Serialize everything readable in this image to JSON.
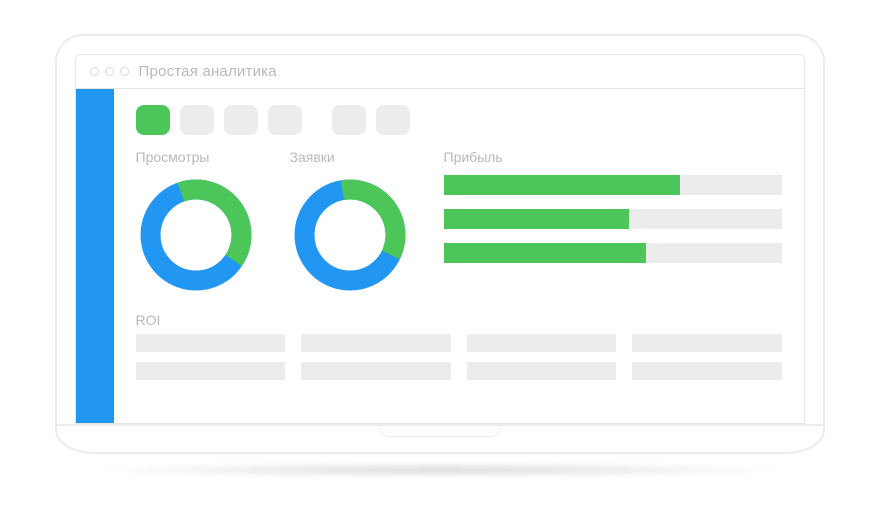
{
  "window": {
    "title": "Простая аналитика"
  },
  "tabs": {
    "count": 6,
    "active_index": 0
  },
  "sections": {
    "views": {
      "label": "Просмотры"
    },
    "requests": {
      "label": "Заявки"
    },
    "profit": {
      "label": "Прибыль"
    },
    "roi": {
      "label": "ROI"
    }
  },
  "colors": {
    "accent_blue": "#2196f3",
    "accent_green": "#4cc659",
    "muted_gray": "#ececec",
    "text_muted": "#b9b9b9"
  },
  "chart_data": [
    {
      "type": "pie",
      "title": "Просмотры",
      "series": [
        {
          "name": "green",
          "value": 40,
          "color": "#4cc659"
        },
        {
          "name": "blue",
          "value": 60,
          "color": "#2196f3"
        }
      ]
    },
    {
      "type": "pie",
      "title": "Заявки",
      "series": [
        {
          "name": "green",
          "value": 35,
          "color": "#4cc659"
        },
        {
          "name": "blue",
          "value": 65,
          "color": "#2196f3"
        }
      ]
    },
    {
      "type": "bar",
      "title": "Прибыль",
      "categories": [
        "row1",
        "row2",
        "row3"
      ],
      "values": [
        70,
        55,
        60
      ],
      "ylim": [
        0,
        100
      ]
    }
  ],
  "roi_grid": {
    "columns": 4,
    "rows": 2
  }
}
